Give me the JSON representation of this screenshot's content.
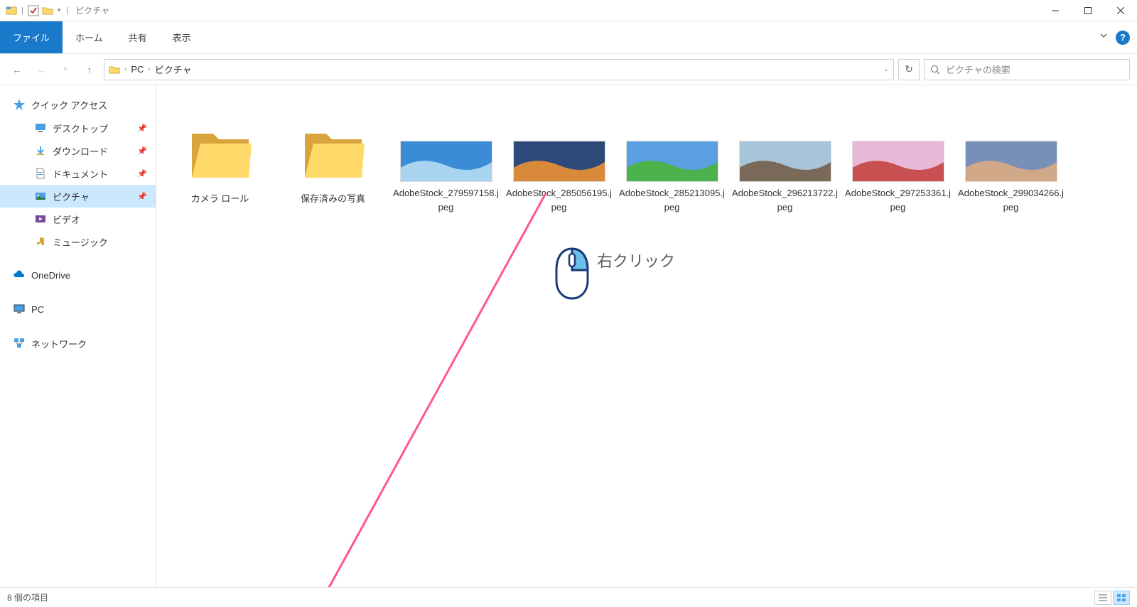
{
  "window": {
    "title": "ピクチャ"
  },
  "tabs": {
    "file": "ファイル",
    "home": "ホーム",
    "share": "共有",
    "view": "表示"
  },
  "breadcrumb": {
    "parts": [
      "PC",
      "ピクチャ"
    ]
  },
  "search": {
    "placeholder": "ピクチャの検索"
  },
  "sidebar": {
    "quick_access": "クイック アクセス",
    "items": [
      {
        "label": "デスクトップ"
      },
      {
        "label": "ダウンロード"
      },
      {
        "label": "ドキュメント"
      },
      {
        "label": "ピクチャ"
      },
      {
        "label": "ビデオ"
      },
      {
        "label": "ミュージック"
      }
    ],
    "onedrive": "OneDrive",
    "pc": "PC",
    "network": "ネットワーク"
  },
  "files": [
    {
      "type": "folder",
      "name": "カメラ ロール"
    },
    {
      "type": "folder",
      "name": "保存済みの写真"
    },
    {
      "type": "image",
      "name": "AdobeStock_279597158.jpeg",
      "colors": [
        "#3a8cd6",
        "#a8d4f0"
      ]
    },
    {
      "type": "image",
      "name": "AdobeStock_285056195.jpeg",
      "colors": [
        "#2d4a7a",
        "#d88a3a"
      ]
    },
    {
      "type": "image",
      "name": "AdobeStock_285213095.jpeg",
      "colors": [
        "#5aa0e0",
        "#4cb24c"
      ]
    },
    {
      "type": "image",
      "name": "AdobeStock_296213722.jpeg",
      "colors": [
        "#a8c4d8",
        "#7a6858"
      ]
    },
    {
      "type": "image",
      "name": "AdobeStock_297253361.jpeg",
      "colors": [
        "#e8b8d8",
        "#c85050"
      ]
    },
    {
      "type": "image",
      "name": "AdobeStock_299034266.jpeg",
      "colors": [
        "#7890b8",
        "#d0a888"
      ]
    }
  ],
  "status": {
    "count": "8 個の項目"
  },
  "annotation": {
    "text": "右クリック"
  }
}
